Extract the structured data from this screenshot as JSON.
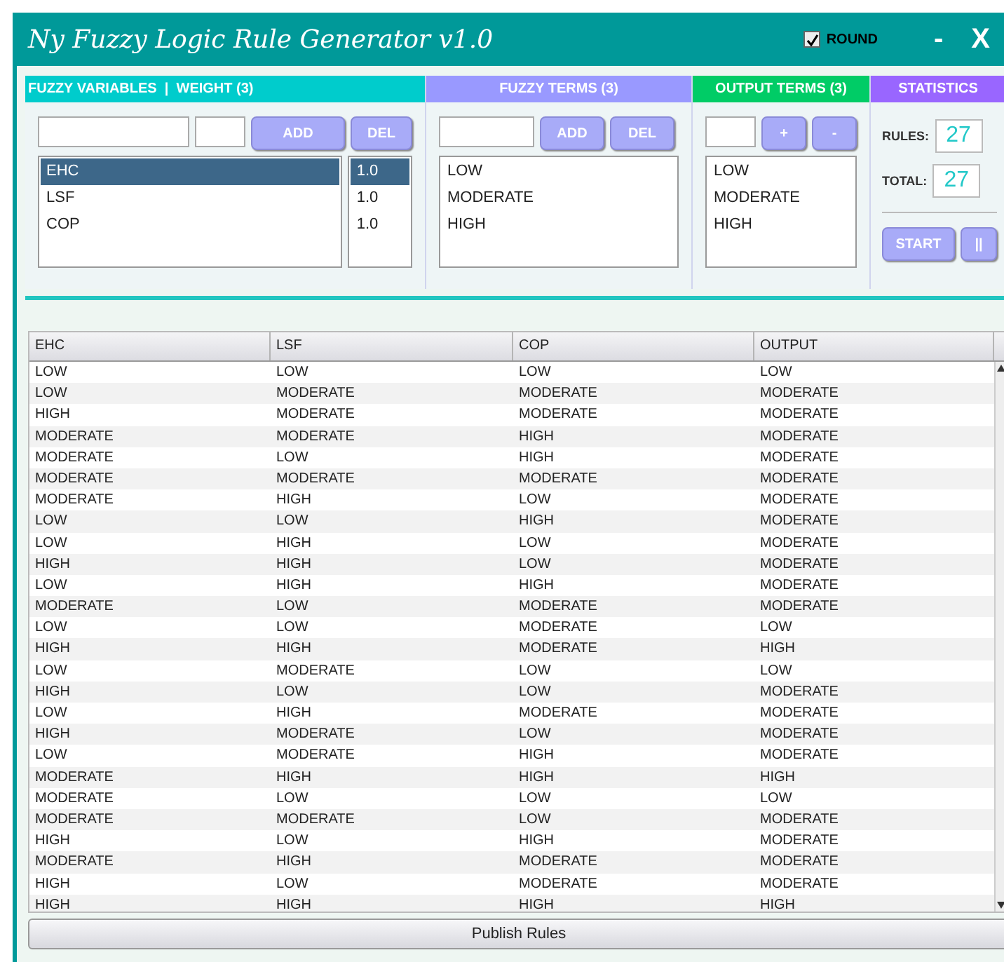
{
  "window": {
    "title": "Ny Fuzzy Logic Rule Generator v1.0",
    "round_checkbox": {
      "label": "ROUND",
      "checked": true
    },
    "minimize": "-",
    "close": "X"
  },
  "variables": {
    "title": "FUZZY VARIABLES  |  WEIGHT (3)",
    "buttons": [
      "ADD",
      "DEL"
    ],
    "items": [
      {
        "name": "EHC",
        "weight": "1.0",
        "selected": true
      },
      {
        "name": "LSF",
        "weight": "1.0",
        "selected": false
      },
      {
        "name": "COP",
        "weight": "1.0",
        "selected": false
      }
    ]
  },
  "fuzzy_terms": {
    "title": "FUZZY TERMS (3)",
    "buttons": [
      "ADD",
      "DEL"
    ],
    "items": [
      {
        "label": "LOW",
        "selected": false
      },
      {
        "label": "MODERATE",
        "selected": false
      },
      {
        "label": "HIGH",
        "selected": false
      }
    ]
  },
  "output_terms": {
    "title": "OUTPUT TERMS (3)",
    "buttons": [
      "+",
      "-"
    ],
    "items": [
      {
        "label": "LOW",
        "selected": false
      },
      {
        "label": "MODERATE",
        "selected": false
      },
      {
        "label": "HIGH",
        "selected": false
      }
    ]
  },
  "statistics": {
    "title": "STATISTICS",
    "rules_label": "RULES:",
    "rules": "27",
    "total_label": "TOTAL:",
    "total": "27",
    "buttons": [
      "START",
      "||"
    ]
  },
  "table": {
    "columns": [
      "EHC",
      "LSF",
      "COP",
      "OUTPUT"
    ],
    "rows": [
      [
        "LOW",
        "LOW",
        "LOW",
        "LOW"
      ],
      [
        "LOW",
        "MODERATE",
        "MODERATE",
        "MODERATE"
      ],
      [
        "HIGH",
        "MODERATE",
        "MODERATE",
        "MODERATE"
      ],
      [
        "MODERATE",
        "MODERATE",
        "HIGH",
        "MODERATE"
      ],
      [
        "MODERATE",
        "LOW",
        "HIGH",
        "MODERATE"
      ],
      [
        "MODERATE",
        "MODERATE",
        "MODERATE",
        "MODERATE"
      ],
      [
        "MODERATE",
        "HIGH",
        "LOW",
        "MODERATE"
      ],
      [
        "LOW",
        "LOW",
        "HIGH",
        "MODERATE"
      ],
      [
        "LOW",
        "HIGH",
        "LOW",
        "MODERATE"
      ],
      [
        "HIGH",
        "HIGH",
        "LOW",
        "MODERATE"
      ],
      [
        "LOW",
        "HIGH",
        "HIGH",
        "MODERATE"
      ],
      [
        "MODERATE",
        "LOW",
        "MODERATE",
        "MODERATE"
      ],
      [
        "LOW",
        "LOW",
        "MODERATE",
        "LOW"
      ],
      [
        "HIGH",
        "HIGH",
        "MODERATE",
        "HIGH"
      ],
      [
        "LOW",
        "MODERATE",
        "LOW",
        "LOW"
      ],
      [
        "HIGH",
        "LOW",
        "LOW",
        "MODERATE"
      ],
      [
        "LOW",
        "HIGH",
        "MODERATE",
        "MODERATE"
      ],
      [
        "HIGH",
        "MODERATE",
        "LOW",
        "MODERATE"
      ],
      [
        "LOW",
        "MODERATE",
        "HIGH",
        "MODERATE"
      ],
      [
        "MODERATE",
        "HIGH",
        "HIGH",
        "HIGH"
      ],
      [
        "MODERATE",
        "LOW",
        "LOW",
        "LOW"
      ],
      [
        "MODERATE",
        "MODERATE",
        "LOW",
        "MODERATE"
      ],
      [
        "HIGH",
        "LOW",
        "HIGH",
        "MODERATE"
      ],
      [
        "MODERATE",
        "HIGH",
        "MODERATE",
        "MODERATE"
      ],
      [
        "HIGH",
        "LOW",
        "MODERATE",
        "MODERATE"
      ],
      [
        "HIGH",
        "HIGH",
        "HIGH",
        "HIGH"
      ]
    ]
  },
  "publish_button": "Publish Rules"
}
